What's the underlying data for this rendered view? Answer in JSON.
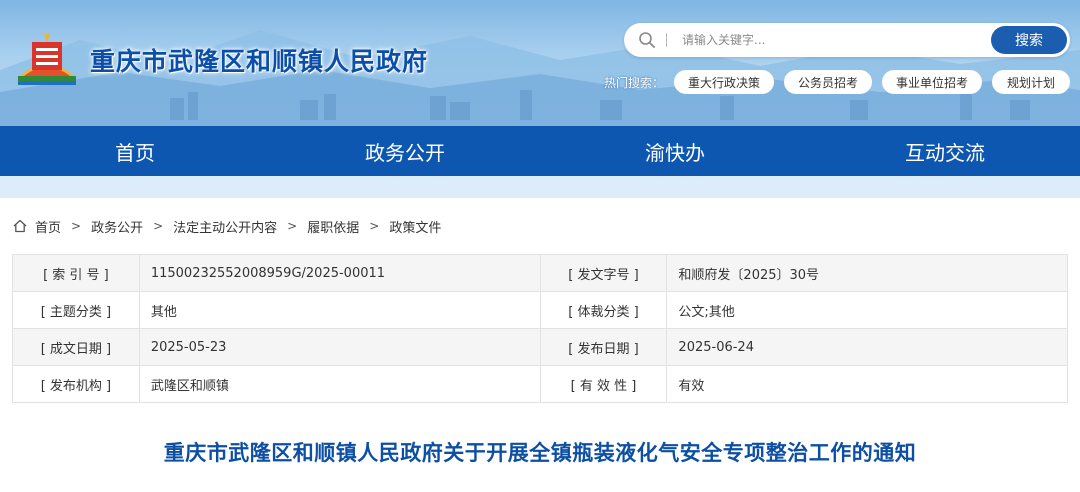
{
  "header": {
    "site_title": "重庆市武隆区和顺镇人民政府",
    "colors": {
      "brand_blue": "#0d57b0",
      "title_blue": "#0c4fa8",
      "strip": "#dcedf9"
    }
  },
  "search": {
    "placeholder": "请输入关键字...",
    "button_label": "搜索",
    "icon": "search-icon"
  },
  "hot_search": {
    "label": "热门搜索：",
    "tags": [
      "重大行政决策",
      "公务员招考",
      "事业单位招考",
      "规划计划"
    ]
  },
  "nav": {
    "items": [
      "首页",
      "政务公开",
      "渝快办",
      "互动交流"
    ]
  },
  "breadcrumb": {
    "home_icon": "home-icon",
    "items": [
      "首页",
      "政务公开",
      "法定主动公开内容",
      "履职依据",
      "政策文件"
    ],
    "separator": ">"
  },
  "meta": {
    "rows": [
      {
        "label_left": "[ 索 引 号 ]",
        "value_left": "11500232552008959G/2025-00011",
        "label_right": "[ 发文字号 ]",
        "value_right": "和顺府发〔2025〕30号"
      },
      {
        "label_left": "[ 主题分类 ]",
        "value_left": "其他",
        "label_right": "[ 体裁分类 ]",
        "value_right": "公文;其他"
      },
      {
        "label_left": "[ 成文日期 ]",
        "value_left": "2025-05-23",
        "label_right": "[ 发布日期 ]",
        "value_right": "2025-06-24"
      },
      {
        "label_left": "[ 发布机构 ]",
        "value_left": "武隆区和顺镇",
        "label_right": "[ 有 效 性 ]",
        "value_right": "有效"
      }
    ]
  },
  "article": {
    "title": "重庆市武隆区和顺镇人民政府关于开展全镇瓶装液化气安全专项整治工作的通知"
  }
}
